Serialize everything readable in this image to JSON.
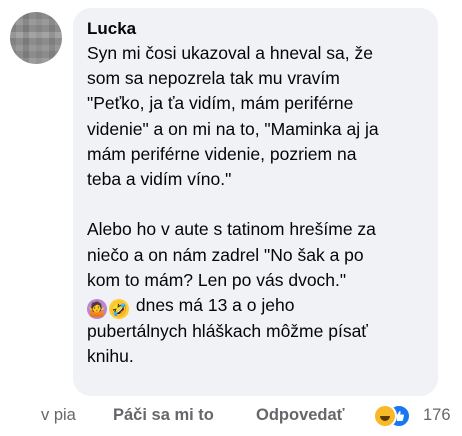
{
  "comment": {
    "author": "Lucka",
    "lines_p1": [
      "Syn mi čosi ukazoval a hneval sa, že",
      "som sa nepozrela tak mu vravím",
      "\"Peťko, ja ťa vidím, mám periférne",
      "videnie\" a on mi na to, \"Maminka aj ja",
      "mám periférne videnie, pozriem na",
      "teba a vidím víno.\""
    ],
    "lines_p2": [
      "Alebo ho v aute s tatinom hrešíme za",
      "niečo a on nám zadrel \"No šak a po",
      "kom to mám? Len po vás dvoch.\""
    ],
    "emoji_line_text": " dnes má 13 a o jeho",
    "lines_p2_end": [
      "pubertálnych hláškach môžme písať",
      "knihu."
    ],
    "emojis": [
      "person-shrugging-icon",
      "rofl-icon"
    ]
  },
  "actions": {
    "timestamp": "v pia",
    "like_label": "Páči sa mi to",
    "reply_label": "Odpovedať",
    "reaction_count": "176",
    "reaction_icons": [
      "haha-icon",
      "like-icon"
    ]
  },
  "colors": {
    "bubble": "#f0f2f5",
    "secondary_text": "#65676b",
    "like_blue": "#1877f2",
    "haha_yellow": "#f7b928"
  }
}
